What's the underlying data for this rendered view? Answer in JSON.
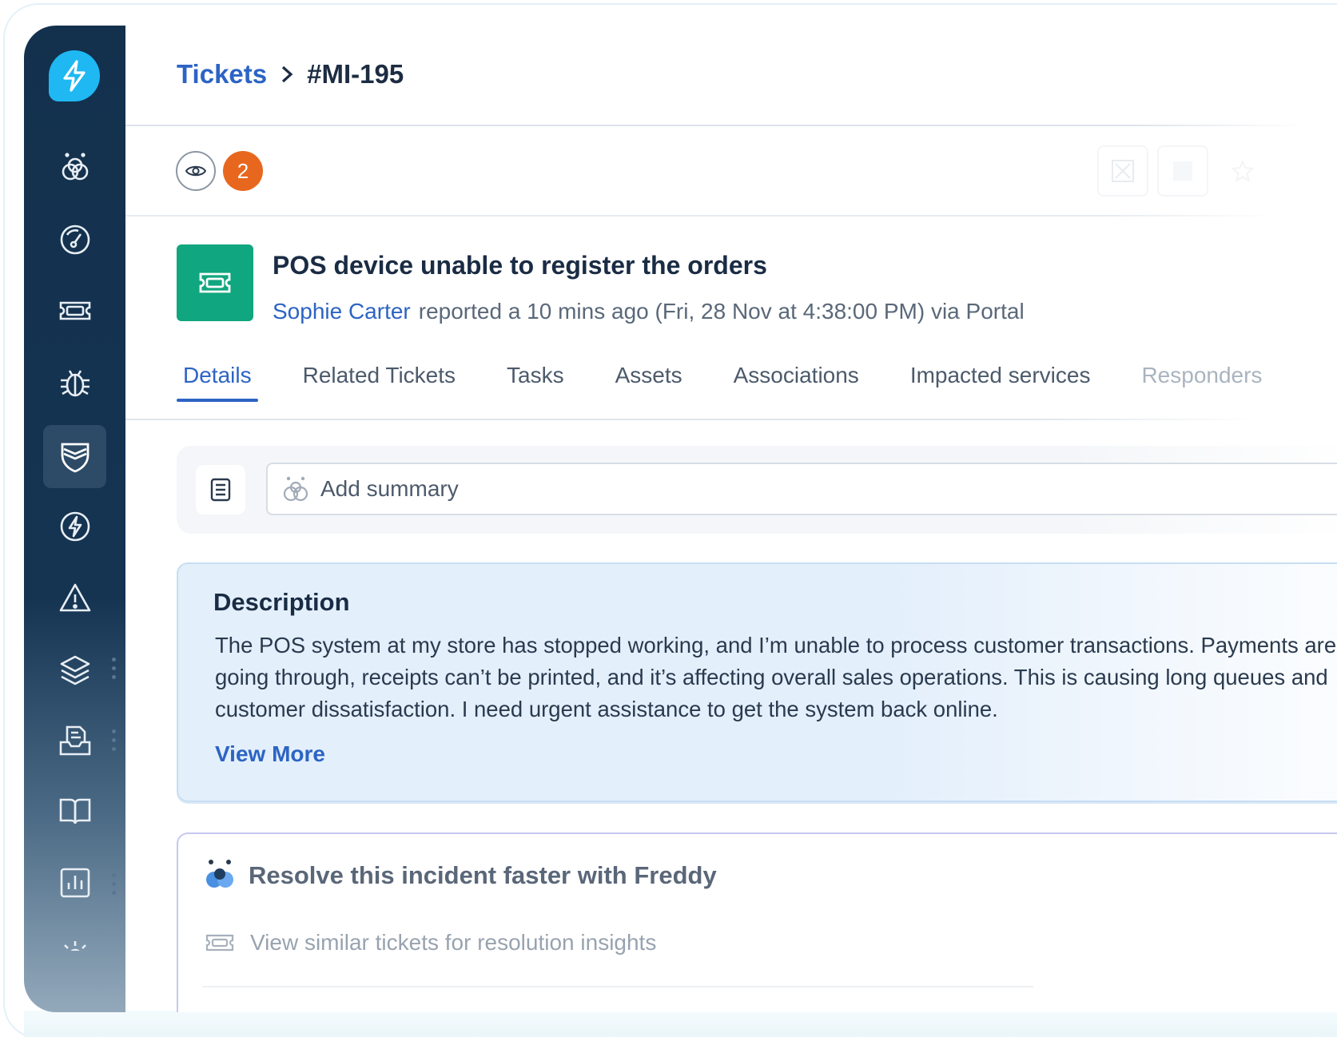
{
  "breadcrumb": {
    "parent": "Tickets",
    "current": "#MI-195"
  },
  "watchers": {
    "count": "2"
  },
  "ticket": {
    "title": "POS device unable to register the orders",
    "reporter": "Sophie Carter",
    "meta": "reported a 10 mins ago (Fri, 28 Nov at 4:38:00 PM) via Portal"
  },
  "tabs": [
    {
      "label": "Details"
    },
    {
      "label": "Related Tickets"
    },
    {
      "label": "Tasks"
    },
    {
      "label": "Assets"
    },
    {
      "label": "Associations"
    },
    {
      "label": "Impacted services"
    },
    {
      "label": "Responders"
    }
  ],
  "summary": {
    "placeholder": "Add summary"
  },
  "description": {
    "title": "Description",
    "lines": [
      "The POS system at my store has stopped working, and I’m unable to process customer transactions. Payments aren’t",
      "going through, receipts can’t be printed, and it’s affecting overall sales operations. This is causing long queues and",
      "customer dissatisfaction. I need urgent assistance to get the system back online."
    ],
    "view_more": "View More"
  },
  "freddy": {
    "title": "Resolve this incident faster with Freddy",
    "suggestion": "View similar tickets for resolution insights"
  },
  "colors": {
    "sidebar": "#13314d",
    "accent": "#2c64c4",
    "logo": "#1fb8f2",
    "ticket_icon": "#10a67f",
    "badge": "#e8671e"
  },
  "icons": {
    "sidebar": [
      "freddy-icon",
      "dashboard-icon",
      "tickets-icon",
      "problems-icon",
      "incidents-icon",
      "changes-icon",
      "alerts-icon",
      "assets-icon",
      "releases-icon",
      "solutions-icon",
      "reports-icon",
      "settings-icon"
    ]
  }
}
